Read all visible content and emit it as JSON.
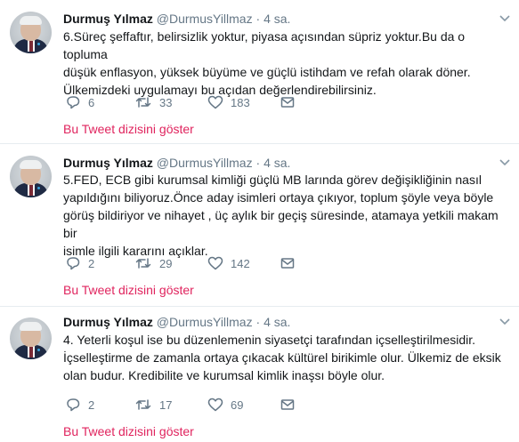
{
  "tweets": [
    {
      "name": "Durmuş Yılmaz",
      "handle": "@DurmusYillmaz",
      "separator": "·",
      "time": "4 sa.",
      "lines": [
        "6.Süreç şeffaftır, belirsizlik yoktur, piyasa açısından süpriz yoktur.Bu da o topluma",
        "düşük enflasyon, yüksek büyüme ve güçlü istihdam ve refah olarak döner.",
        "Ülkemizdeki uygulamayı bu açıdan değerlendirebilirsiniz."
      ],
      "replies": "6",
      "retweets": "33",
      "likes": "183",
      "thread_link": "Bu Tweet dizisini göster"
    },
    {
      "name": "Durmuş Yılmaz",
      "handle": "@DurmusYillmaz",
      "separator": "·",
      "time": "4 sa.",
      "lines": [
        "5.FED, ECB gibi kurumsal kimliği güçlü MB larında görev değişikliğinin nasıl",
        "yapıldığını biliyoruz.Önce aday isimleri ortaya çıkıyor, toplum şöyle veya böyle",
        "görüş bildiriyor ve nihayet , üç aylık bir geçiş süresinde, atamaya yetkili makam bir",
        "isimle ilgili kararını açıklar."
      ],
      "replies": "2",
      "retweets": "29",
      "likes": "142",
      "thread_link": "Bu Tweet dizisini göster"
    },
    {
      "name": "Durmuş Yılmaz",
      "handle": "@DurmusYillmaz",
      "separator": "·",
      "time": "4 sa.",
      "lines": [
        "4. Yeterli koşul ise bu düzenlemenin siyasetçi tarafından içselleştirilmesidir.",
        "İçselleştirme de zamanla ortaya çıkacak kültürel birikimle olur. Ülkemiz de eksik",
        "olan budur. Kredibilite ve kurumsal kimlik inaşsı böyle olur."
      ],
      "replies": "2",
      "retweets": "17",
      "likes": "69",
      "thread_link": "Bu Tweet dizisini göster"
    }
  ],
  "icons": {
    "reply": "reply-icon",
    "retweet": "retweet-icon",
    "like": "heart-icon",
    "dm": "envelope-icon",
    "caret": "chevron-down-icon"
  },
  "colors": {
    "accent": "#e0245e",
    "secondary_text": "#657786",
    "divider": "#e6ecf0"
  }
}
